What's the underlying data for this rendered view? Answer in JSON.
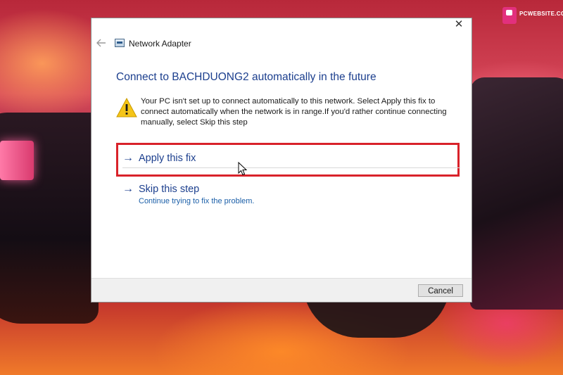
{
  "watermark": {
    "logo_text": "PCWEBSITE.COM",
    "accent": "#e2307d"
  },
  "dialog": {
    "title": "Network Adapter",
    "close_symbol": "✕",
    "back_icon": "back-arrow-icon",
    "heading": "Connect to BACHDUONG2 automatically in the future",
    "message": "Your PC isn't set up to connect automatically to this network. Select Apply this fix to connect automatically when the network is in range.If you'd rather continue connecting manually, select Skip this step",
    "options": [
      {
        "arrow": "→",
        "label": "Apply this fix",
        "description": "",
        "highlighted": true
      },
      {
        "arrow": "→",
        "label": "Skip this step",
        "description": "Continue trying to fix the problem."
      }
    ],
    "footer": {
      "cancel_label": "Cancel"
    },
    "colors": {
      "heading": "#1c3f8e",
      "link_desc": "#1b5fa8",
      "highlight": "#d9222a",
      "warning": "#f5c518"
    }
  }
}
